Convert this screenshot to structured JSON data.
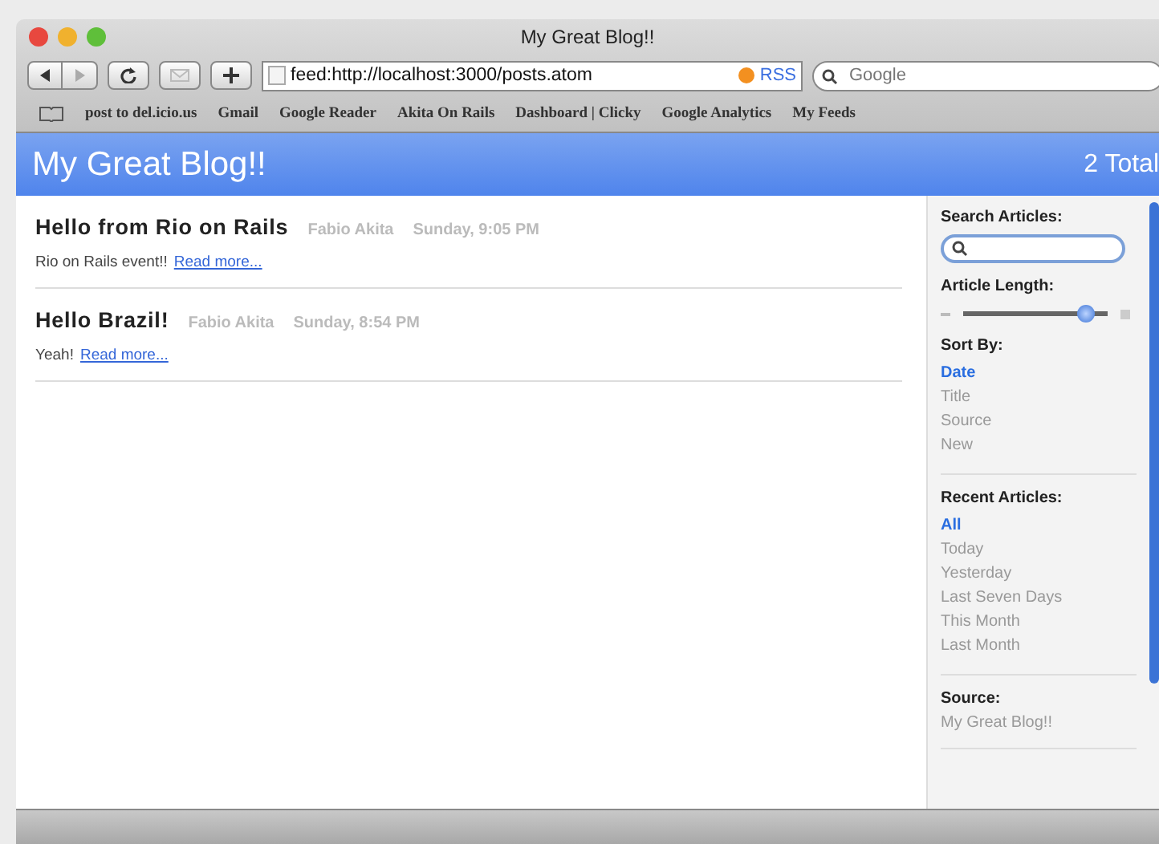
{
  "window": {
    "title": "My Great Blog!!"
  },
  "toolbar": {
    "address": "feed:http://localhost:3000/posts.atom",
    "rss": "RSS",
    "search": {
      "placeholder": "Google"
    }
  },
  "bookmarks": [
    "post to del.icio.us",
    "Gmail",
    "Google Reader",
    "Akita On Rails",
    "Dashboard | Clicky",
    "Google Analytics",
    "My Feeds"
  ],
  "header": {
    "title": "My Great Blog!!",
    "total": "2 Total"
  },
  "articles": [
    {
      "title": "Hello from Rio on Rails",
      "author": "Fabio Akita",
      "date": "Sunday, 9:05 PM",
      "summary": "Rio on Rails event!!",
      "link": "Read more..."
    },
    {
      "title": "Hello Brazil!",
      "author": "Fabio Akita",
      "date": "Sunday, 8:54 PM",
      "summary": "Yeah!",
      "link": "Read more..."
    }
  ],
  "sidebar": {
    "search_label": "Search Articles:",
    "length_label": "Article Length:",
    "length": {
      "level": 0.9
    },
    "sort_label": "Sort By:",
    "sort": [
      {
        "label": "Date",
        "selected": true
      },
      {
        "label": "Title",
        "selected": false
      },
      {
        "label": "Source",
        "selected": false
      },
      {
        "label": "New",
        "selected": false
      }
    ],
    "recent_label": "Recent Articles:",
    "recent": [
      {
        "label": "All",
        "selected": true
      },
      {
        "label": "Today",
        "selected": false
      },
      {
        "label": "Yesterday",
        "selected": false
      },
      {
        "label": "Last Seven Days",
        "selected": false
      },
      {
        "label": "This Month",
        "selected": false
      },
      {
        "label": "Last Month",
        "selected": false
      }
    ],
    "source_label": "Source:",
    "source": "My Great Blog!!"
  }
}
